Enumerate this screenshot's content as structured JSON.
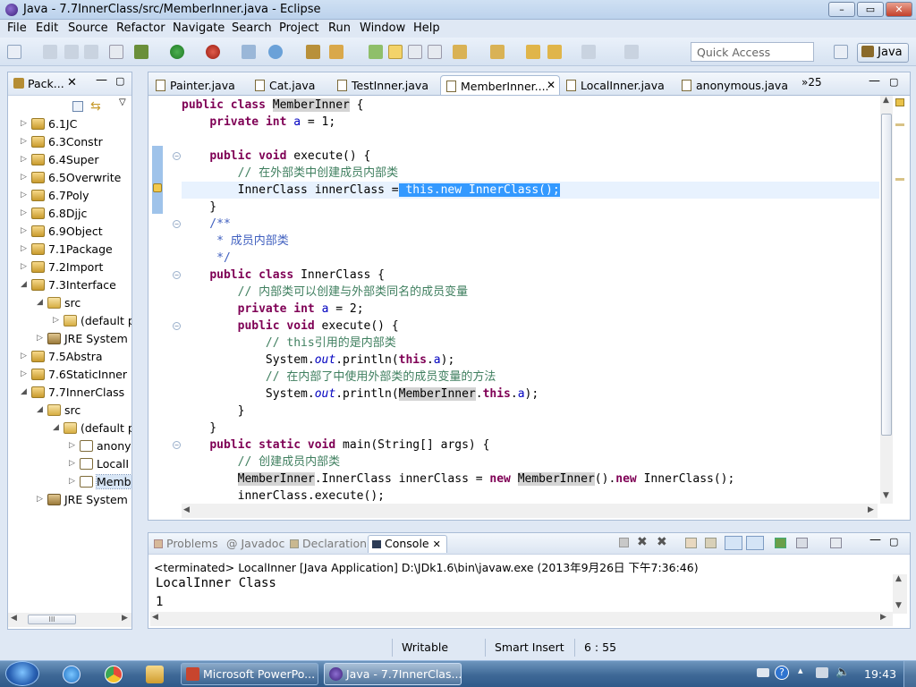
{
  "window": {
    "title": "Java - 7.7InnerClass/src/MemberInner.java - Eclipse",
    "minimize": "–",
    "maximize": "▭",
    "close": "✕"
  },
  "menubar": [
    "File",
    "Edit",
    "Source",
    "Refactor",
    "Navigate",
    "Search",
    "Project",
    "Run",
    "Window",
    "Help"
  ],
  "toolbar": {
    "quick_access_placeholder": "Quick Access",
    "perspective": "Java"
  },
  "package_explorer": {
    "title": "Pack...",
    "items": [
      {
        "label": "6.1JC",
        "icon": "project-icon",
        "level": 0,
        "expanded": false
      },
      {
        "label": "6.3Constr",
        "icon": "project-icon",
        "level": 0,
        "expanded": false
      },
      {
        "label": "6.4Super",
        "icon": "project-icon",
        "level": 0,
        "expanded": false
      },
      {
        "label": "6.5Overwrite",
        "icon": "project-icon",
        "level": 0,
        "expanded": false
      },
      {
        "label": "6.7Poly",
        "icon": "project-icon",
        "level": 0,
        "expanded": false
      },
      {
        "label": "6.8Djjc",
        "icon": "project-icon",
        "level": 0,
        "expanded": false
      },
      {
        "label": "6.9Object",
        "icon": "project-icon",
        "level": 0,
        "expanded": false
      },
      {
        "label": "7.1Package",
        "icon": "project-icon",
        "level": 0,
        "expanded": false
      },
      {
        "label": "7.2Import",
        "icon": "project-icon",
        "level": 0,
        "expanded": false
      },
      {
        "label": "7.3Interface",
        "icon": "project-icon",
        "level": 0,
        "expanded": true
      },
      {
        "label": "src",
        "icon": "source-folder-icon",
        "level": 1,
        "expanded": true
      },
      {
        "label": "(default p",
        "icon": "package-icon",
        "level": 2,
        "expanded": false
      },
      {
        "label": "JRE System L",
        "icon": "library-icon",
        "level": 1,
        "expanded": false
      },
      {
        "label": "7.5Abstra",
        "icon": "project-icon",
        "level": 0,
        "expanded": false
      },
      {
        "label": "7.6StaticInner",
        "icon": "project-icon",
        "level": 0,
        "expanded": false
      },
      {
        "label": "7.7InnerClass",
        "icon": "project-icon",
        "level": 0,
        "expanded": true
      },
      {
        "label": "src",
        "icon": "source-folder-icon",
        "level": 1,
        "expanded": true
      },
      {
        "label": "(default p",
        "icon": "package-icon",
        "level": 2,
        "expanded": true
      },
      {
        "label": "anony",
        "icon": "java-file-icon",
        "level": 3,
        "expanded": false
      },
      {
        "label": "LocalI",
        "icon": "java-file-icon",
        "level": 3,
        "expanded": false
      },
      {
        "label": "Memb",
        "icon": "java-file-icon",
        "level": 3,
        "expanded": false,
        "selected": true
      },
      {
        "label": "JRE System L",
        "icon": "library-icon",
        "level": 1,
        "expanded": false
      }
    ],
    "hscroll_thumb": "III"
  },
  "editor": {
    "tabs": [
      {
        "label": "Painter.java",
        "active": false
      },
      {
        "label": "Cat.java",
        "active": false
      },
      {
        "label": "TestInner.java",
        "active": false
      },
      {
        "label": "MemberInner....",
        "active": true
      },
      {
        "label": "LocalInner.java",
        "active": false
      },
      {
        "label": "anonymous.java",
        "active": false
      }
    ],
    "overflow": "»25",
    "lines": [
      "public class MemberInner {",
      "    private int a = 1;",
      "",
      "    public void execute() {",
      "        // 在外部类中创建成员内部类",
      "        InnerClass innerClass = this.new InnerClass();",
      "    }",
      "    /**",
      "     * 成员内部类",
      "     */",
      "    public class InnerClass {",
      "        // 内部类可以创建与外部类同名的成员变量",
      "        private int a = 2;",
      "        public void execute() {",
      "            // this引用的是内部类",
      "            System.out.println(this.a);",
      "            // 在内部了中使用外部类的成员变量的方法",
      "            System.out.println(MemberInner.this.a);",
      "        }",
      "    }",
      "    public static void main(String[] args) {",
      "        // 创建成员内部类",
      "        MemberInner.InnerClass innerClass = new MemberInner().new InnerClass();",
      "        innerClass.execute();"
    ]
  },
  "bottom_panel": {
    "tabs": [
      {
        "label": "Problems",
        "active": false
      },
      {
        "label": "@ Javadoc",
        "active": false
      },
      {
        "label": "Declaration",
        "active": false
      },
      {
        "label": "Console",
        "active": true
      }
    ],
    "console_header": "<terminated> LocalInner [Java Application] D:\\JDk1.6\\bin\\javaw.exe (2013年9月26日 下午7:36:46)",
    "console_output": [
      "LocalInner Class",
      "1"
    ]
  },
  "statusbar": {
    "writable": "Writable",
    "insert_mode": "Smart Insert",
    "position": "6 : 55"
  },
  "taskbar": {
    "apps": [
      {
        "label": "Microsoft PowerPo...",
        "active": false
      },
      {
        "label": "Java - 7.7InnerClas...",
        "active": true
      }
    ],
    "clock": "19:43"
  },
  "colors": {
    "keyword": "#7f0055",
    "comment": "#3f7f5f",
    "javadoc": "#3f5fbf",
    "field": "#0000c0",
    "selection": "#3399ff"
  }
}
